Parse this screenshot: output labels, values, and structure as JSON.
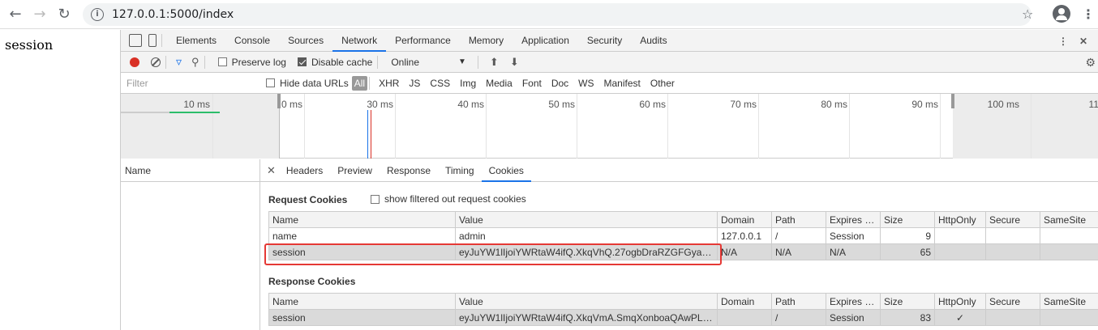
{
  "browser": {
    "url": "127.0.0.1:5000/index"
  },
  "page": {
    "body_text": "session"
  },
  "devtools": {
    "tabs": [
      "Elements",
      "Console",
      "Sources",
      "Network",
      "Performance",
      "Memory",
      "Application",
      "Security",
      "Audits"
    ],
    "active_tab": "Network",
    "toolbar": {
      "preserve_log": "Preserve log",
      "disable_cache": "Disable cache",
      "throttle": "Online"
    },
    "filterbar": {
      "filter_placeholder": "Filter",
      "hide_data_urls": "Hide data URLs",
      "types": [
        "All",
        "XHR",
        "JS",
        "CSS",
        "Img",
        "Media",
        "Font",
        "Doc",
        "WS",
        "Manifest",
        "Other"
      ]
    },
    "timeline": {
      "ticks": [
        "10 ms",
        "0 ms",
        "30 ms",
        "40 ms",
        "50 ms",
        "60 ms",
        "70 ms",
        "80 ms",
        "90 ms",
        "100 ms",
        "11"
      ]
    },
    "names_header": "Name",
    "detail_tabs": [
      "Headers",
      "Preview",
      "Response",
      "Timing",
      "Cookies"
    ],
    "active_detail_tab": "Cookies",
    "request_cookies": {
      "title": "Request Cookies",
      "show_filtered": "show filtered out request cookies",
      "columns": [
        "Name",
        "Value",
        "Domain",
        "Path",
        "Expires / ...",
        "Size",
        "HttpOnly",
        "Secure",
        "SameSite"
      ],
      "rows": [
        [
          "name",
          "admin",
          "127.0.0.1",
          "/",
          "Session",
          "9",
          "",
          "",
          ""
        ],
        [
          "session",
          "eyJuYW1lIjoiYWRtaW4ifQ.XkqVhQ.27ogbDraRZGFGyauD...",
          "N/A",
          "N/A",
          "N/A",
          "65",
          "",
          "",
          ""
        ]
      ]
    },
    "response_cookies": {
      "title": "Response Cookies",
      "columns": [
        "Name",
        "Value",
        "Domain",
        "Path",
        "Expires / ...",
        "Size",
        "HttpOnly",
        "Secure",
        "SameSite"
      ],
      "rows": [
        [
          "session",
          "eyJuYW1lIjoiYWRtaW4ifQ.XkqVmA.SmqXonboaQAwPLIZA...",
          "",
          "/",
          "Session",
          "83",
          "✓",
          "",
          ""
        ]
      ]
    }
  },
  "colors": {
    "accent": "#1a73e8",
    "record": "#d93025",
    "highlight": "#e53935"
  }
}
